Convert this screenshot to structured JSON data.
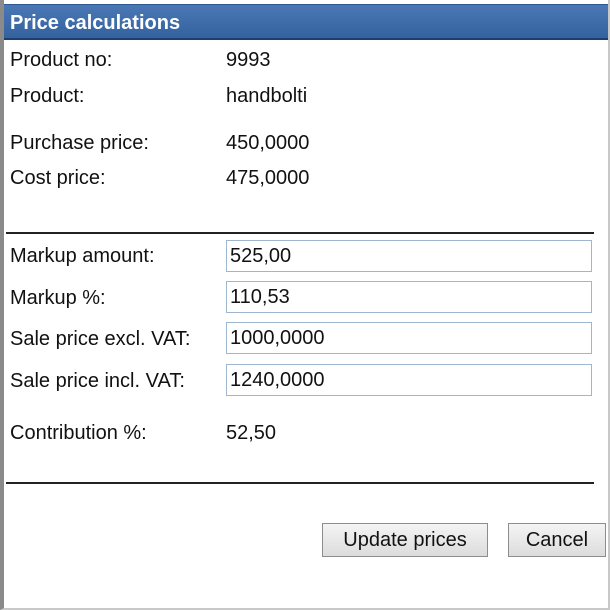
{
  "dialog": {
    "title": "Price calculations"
  },
  "info": {
    "product_no_label": "Product no:",
    "product_no_value": "9993",
    "product_label": "Product:",
    "product_value": "handbolti",
    "purchase_price_label": "Purchase price:",
    "purchase_price_value": "450,0000",
    "cost_price_label": "Cost price:",
    "cost_price_value": "475,0000"
  },
  "fields": {
    "markup_amount_label": "Markup amount:",
    "markup_amount_value": "525,00",
    "markup_pct_label": "Markup %:",
    "markup_pct_value": "110,53",
    "sale_excl_label": "Sale price excl. VAT:",
    "sale_excl_value": "1000,0000",
    "sale_incl_label": "Sale price incl. VAT:",
    "sale_incl_value": "1240,0000"
  },
  "summary": {
    "contribution_label": "Contribution %:",
    "contribution_value": "52,50"
  },
  "buttons": {
    "update_label": "Update prices",
    "cancel_label": "Cancel"
  }
}
